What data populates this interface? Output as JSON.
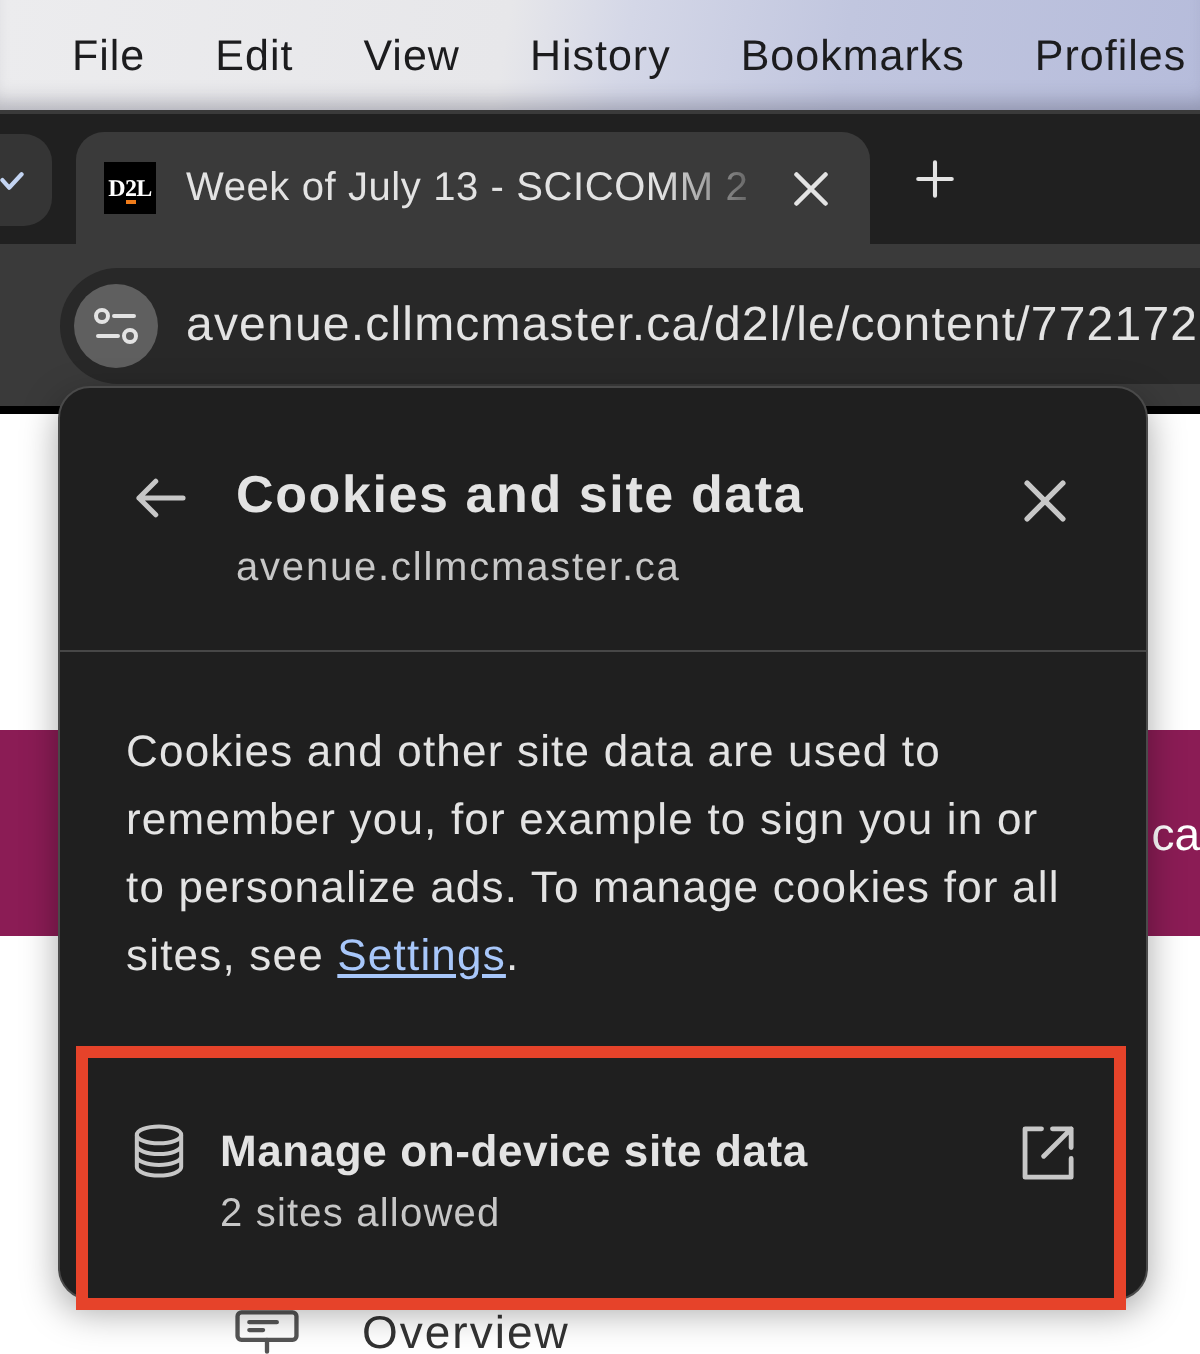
{
  "menu_bar": {
    "items": [
      "File",
      "Edit",
      "View",
      "History",
      "Bookmarks",
      "Profiles"
    ]
  },
  "tabs": [
    {
      "favicon": "D2L",
      "title": "Week of July 13 - SCICOMM 2",
      "selected": true
    }
  ],
  "address_bar": {
    "url": "avenue.cllmcmaster.ca/d2l/le/content/772172"
  },
  "page": {
    "banner_text": "ca",
    "nav_items": [
      {
        "label": "Overview"
      }
    ]
  },
  "popup": {
    "title": "Cookies and site data",
    "subtitle": "avenue.cllmcmaster.ca",
    "description": {
      "text_before": "Cookies and other site data are used to remember you, for example to sign you in or to personalize ads. To manage cookies for all sites, see ",
      "link": "Settings",
      "text_after": "."
    },
    "manage_row": {
      "label": "Manage on-device site data",
      "detail": "2 sites allowed",
      "highlighted": true
    }
  }
}
